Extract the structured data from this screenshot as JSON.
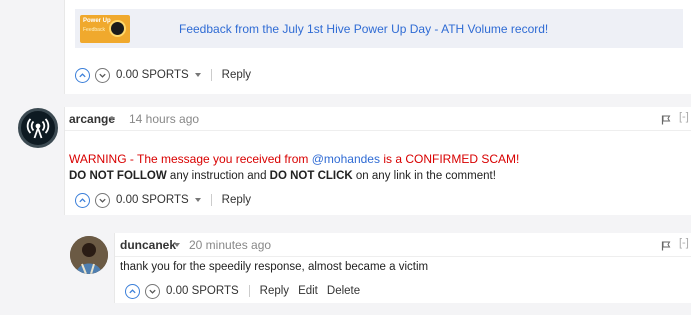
{
  "previous_comment": {
    "thumbnail_text": "Power Up",
    "thumbnail_sub": "Feedback",
    "link_title": "Feedback from the July 1st Hive Power Up Day - ATH Volume record!",
    "payout": "0.00 SPORTS",
    "reply_label": "Reply"
  },
  "comment": {
    "author": "arcange",
    "time_ago": "14 hours ago",
    "collapse_label": "[-]",
    "warning_prefix": "WARNING - The message you received from ",
    "warning_mention": "@mohandes",
    "warning_suffix": " is a CONFIRMED SCAM!",
    "info_bold1": "DO NOT FOLLOW",
    "info_mid": " any instruction and ",
    "info_bold2": "DO NOT CLICK",
    "info_end": " on any link in the comment!",
    "payout": "0.00 SPORTS",
    "reply_label": "Reply"
  },
  "reply": {
    "author": "duncanek",
    "time_ago": "20 minutes ago",
    "collapse_label": "[-]",
    "body": "thank you for the speedily response, almost became a victim",
    "payout": "0.00 SPORTS",
    "reply_label": "Reply",
    "edit_label": "Edit",
    "delete_label": "Delete"
  },
  "colors": {
    "link": "#2f6bd4",
    "warning": "#d80000",
    "upvote_border": "#3b7fd9"
  }
}
